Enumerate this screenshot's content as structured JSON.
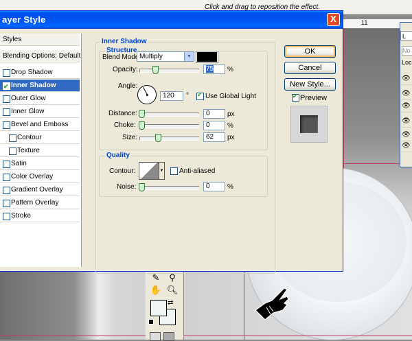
{
  "workspace": {
    "hint": "Click and drag to reposition the effect.",
    "ruler_label": "11",
    "layers_tab": "L",
    "layers_mode": "No",
    "layers_lock": "Loc"
  },
  "dialog": {
    "title": "ayer Style",
    "close_label": "X"
  },
  "styles": {
    "header": "Styles",
    "blending": "Blending Options: Default",
    "items": [
      {
        "label": "Drop Shadow",
        "checked": false
      },
      {
        "label": "Inner Shadow",
        "checked": true,
        "selected": true
      },
      {
        "label": "Outer Glow",
        "checked": false
      },
      {
        "label": "Inner Glow",
        "checked": false
      },
      {
        "label": "Bevel and Emboss",
        "checked": false
      },
      {
        "label": "Contour",
        "checked": false,
        "indent": true
      },
      {
        "label": "Texture",
        "checked": false,
        "indent": true
      },
      {
        "label": "Satin",
        "checked": false
      },
      {
        "label": "Color Overlay",
        "checked": false
      },
      {
        "label": "Gradient Overlay",
        "checked": false
      },
      {
        "label": "Pattern Overlay",
        "checked": false
      },
      {
        "label": "Stroke",
        "checked": false
      }
    ]
  },
  "inner_shadow": {
    "title": "Inner Shadow",
    "structure": {
      "title": "Structure",
      "blend_mode_label": "Blend Mode:",
      "blend_mode_value": "Multiply",
      "shadow_color": "#000000",
      "opacity_label": "Opacity:",
      "opacity_value": "75",
      "opacity_unit": "%",
      "angle_label": "Angle:",
      "angle_value": "120",
      "angle_unit": "°",
      "global_light_label": "Use Global Light",
      "global_light_checked": true,
      "distance_label": "Distance:",
      "distance_value": "0",
      "distance_unit": "px",
      "choke_label": "Choke:",
      "choke_value": "0",
      "choke_unit": "%",
      "size_label": "Size:",
      "size_value": "62",
      "size_unit": "px"
    },
    "quality": {
      "title": "Quality",
      "contour_label": "Contour:",
      "antialiased_label": "Anti-aliased",
      "antialiased_checked": false,
      "noise_label": "Noise:",
      "noise_value": "0",
      "noise_unit": "%"
    }
  },
  "buttons": {
    "ok": "OK",
    "cancel": "Cancel",
    "new_style": "New Style...",
    "preview_label": "Preview",
    "preview_checked": true
  },
  "colors": {
    "title_bar": "#0053ee",
    "selection": "#316ac5",
    "legend_text": "#0046d5",
    "close_button": "#e34a21"
  }
}
